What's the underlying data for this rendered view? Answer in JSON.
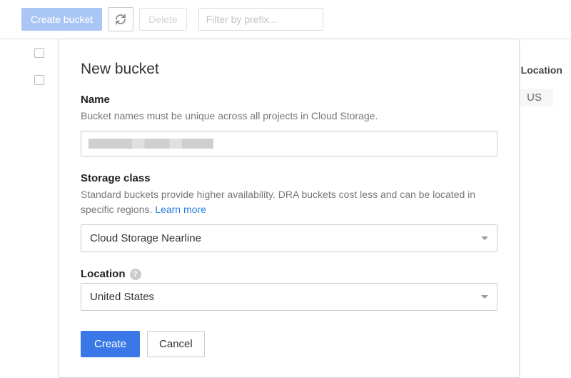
{
  "toolbar": {
    "create_bucket": "Create bucket",
    "delete": "Delete",
    "filter_placeholder": "Filter by prefix..."
  },
  "table": {
    "location_header": "Location",
    "location_value": "US"
  },
  "dialog": {
    "title": "New bucket",
    "name": {
      "label": "Name",
      "hint": "Bucket names must be unique across all projects in Cloud Storage."
    },
    "storage_class": {
      "label": "Storage class",
      "hint": "Standard buckets provide higher availability. DRA buckets cost less and can be located in specific regions. ",
      "learn_more": "Learn more",
      "selected": "Cloud Storage Nearline"
    },
    "location": {
      "label": "Location",
      "selected": "United States"
    },
    "actions": {
      "create": "Create",
      "cancel": "Cancel"
    }
  }
}
